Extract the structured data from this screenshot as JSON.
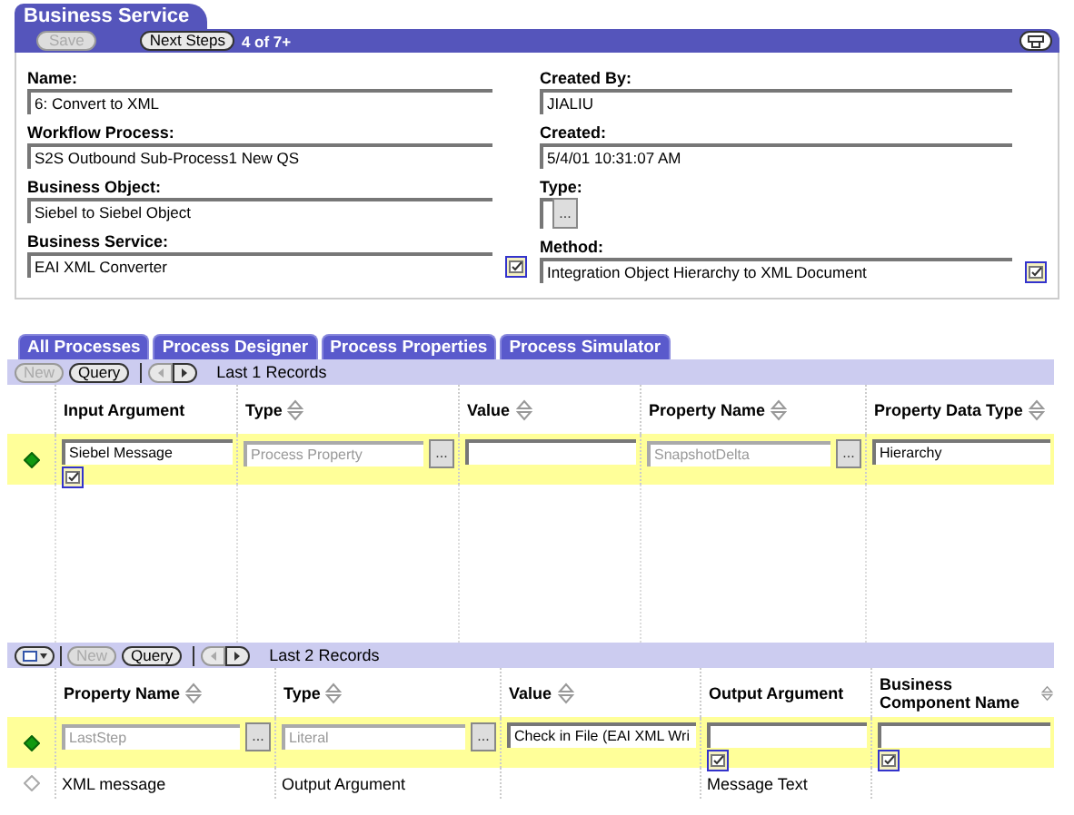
{
  "panel": {
    "title": "Business Service",
    "buttons": [
      {
        "label": "Save",
        "disabled": true
      },
      {
        "label": "Next Steps",
        "disabled": false
      }
    ],
    "record_count": "4 of 7+",
    "left_fields": [
      {
        "label": "Name:",
        "kind": "text",
        "value": "6: Convert to XML"
      },
      {
        "label": "Workflow Process:",
        "kind": "text",
        "value": "S2S Outbound Sub-Process1 New QS"
      },
      {
        "label": "Business Object:",
        "kind": "text",
        "value": "Siebel to Siebel Object"
      },
      {
        "label": "Business Service:",
        "kind": "picker",
        "value": "EAI XML Converter"
      }
    ],
    "right_fields": [
      {
        "label": "Created By:",
        "kind": "text",
        "value": "JIALIU"
      },
      {
        "label": "Created:",
        "kind": "text",
        "value": "5/4/01 10:31:07 AM"
      },
      {
        "label": "Type:",
        "kind": "short_lookup",
        "button": "..."
      },
      {
        "label": "Method:",
        "kind": "picker",
        "value": "Integration Object Hierarchy to XML Document"
      }
    ]
  },
  "view_tabs": [
    {
      "label": "All Processes",
      "selected": false
    },
    {
      "label": "Process Designer",
      "selected": false
    },
    {
      "label": "Process Properties",
      "selected": false
    },
    {
      "label": "Process Simulator",
      "selected": false
    }
  ],
  "lists": [
    {
      "toolbar": [
        {
          "kind": "text",
          "label": "New",
          "disabled": true
        },
        {
          "kind": "text",
          "label": "Query",
          "disabled": false
        },
        {
          "kind": "prev",
          "disabled": true
        },
        {
          "kind": "next",
          "disabled": false
        }
      ],
      "record_count": "Last 1 Records",
      "columns": [
        {
          "label": "Input Argument",
          "sortable": false
        },
        {
          "label": "Type",
          "sortable": true
        },
        {
          "label": "Value",
          "sortable": true
        },
        {
          "label": "Property Name",
          "sortable": true
        },
        {
          "label": "Property Data Type",
          "sortable": true
        }
      ],
      "rows": [
        {
          "selected": true,
          "cells": [
            {
              "kind": "input",
              "value": "Siebel Message",
              "picker": true,
              "disabled": false
            },
            {
              "kind": "lookup",
              "value": "Process Property",
              "button": "...",
              "disabled": true
            },
            {
              "kind": "input",
              "picker": false,
              "disabled": false
            },
            {
              "kind": "lookup",
              "value": "SnapshotDelta",
              "button": "...",
              "disabled": true
            },
            {
              "kind": "input",
              "value": "Hierarchy",
              "picker": false,
              "disabled": false
            }
          ]
        }
      ]
    },
    {
      "toolbar": [
        {
          "kind": "menu",
          "disabled": false
        },
        {
          "kind": "text",
          "label": "New",
          "disabled": true
        },
        {
          "kind": "text",
          "label": "Query",
          "disabled": false
        },
        {
          "kind": "prev",
          "disabled": true
        },
        {
          "kind": "next",
          "disabled": false
        }
      ],
      "record_count": "Last 2 Records",
      "columns": [
        {
          "label": "Property Name",
          "sortable": true
        },
        {
          "label": "Type",
          "sortable": true
        },
        {
          "label": "Value",
          "sortable": true
        },
        {
          "label": "Output Argument",
          "sortable": false
        },
        {
          "label": "Business Component Name",
          "sortable": true
        }
      ],
      "rows": [
        {
          "selected": true,
          "cells": [
            {
              "kind": "lookup",
              "value": "LastStep",
              "button": "...",
              "disabled": true
            },
            {
              "kind": "lookup",
              "value": "Literal",
              "button": "...",
              "disabled": true
            },
            {
              "kind": "input",
              "value": "Check in File (EAI XML Wri",
              "picker": false,
              "disabled": false
            },
            {
              "kind": "input",
              "picker": true,
              "disabled": false
            },
            {
              "kind": "input",
              "picker": true,
              "disabled": false
            }
          ]
        },
        {
          "selected": false,
          "cells": [
            {
              "kind": "text",
              "value": "XML message"
            },
            {
              "kind": "text",
              "value": "Output Argument"
            },
            {
              "kind": "text"
            },
            {
              "kind": "text",
              "value": "Message Text"
            },
            {
              "kind": "text"
            }
          ]
        }
      ]
    }
  ]
}
